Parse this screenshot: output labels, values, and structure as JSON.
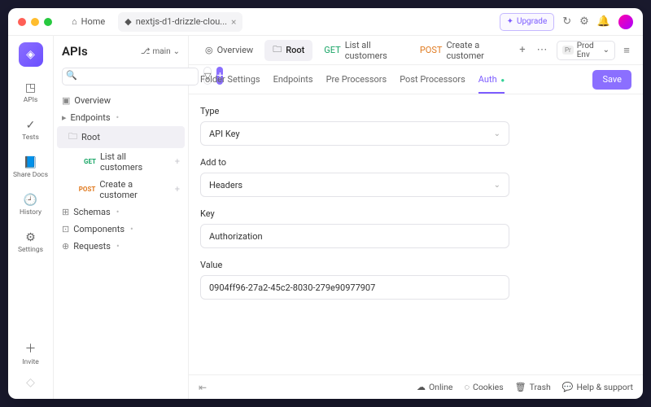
{
  "titlebar": {
    "home_label": "Home",
    "tab_label": "nextjs-d1-drizzle-clou..."
  },
  "top_actions": {
    "upgrade": "Upgrade"
  },
  "rail": {
    "items": [
      {
        "icon": "◳",
        "label": "APIs"
      },
      {
        "icon": "✓",
        "label": "Tests"
      },
      {
        "icon": "📘",
        "label": "Share Docs"
      },
      {
        "icon": "🕘",
        "label": "History"
      },
      {
        "icon": "⚙",
        "label": "Settings"
      }
    ],
    "invite_label": "Invite"
  },
  "sidebar": {
    "title": "APIs",
    "branch": "main",
    "tree": {
      "overview": "Overview",
      "endpoints": "Endpoints",
      "root": "Root",
      "ep1_method": "GET",
      "ep1_label": "List all customers",
      "ep2_method": "POST",
      "ep2_label": "Create a customer",
      "schemas": "Schemas",
      "components": "Components",
      "requests": "Requests"
    }
  },
  "main_tabs": {
    "items": [
      {
        "icon": "👁",
        "label": "Overview"
      },
      {
        "icon": "📁",
        "label": "Root"
      },
      {
        "method": "GET",
        "label": "List all customers"
      },
      {
        "method": "POST",
        "label": "Create a customer"
      }
    ],
    "env": "Prod Env"
  },
  "subtabs": [
    "Folder Settings",
    "Endpoints",
    "Pre Processors",
    "Post Processors",
    "Auth"
  ],
  "save_label": "Save",
  "form": {
    "type_label": "Type",
    "type_value": "API Key",
    "addto_label": "Add to",
    "addto_value": "Headers",
    "key_label": "Key",
    "key_value": "Authorization",
    "value_label": "Value",
    "value_value": "0904ff96-27a2-45c2-8030-279e90977907"
  },
  "footer": {
    "online": "Online",
    "cookies": "Cookies",
    "trash": "Trash",
    "help": "Help & support"
  }
}
